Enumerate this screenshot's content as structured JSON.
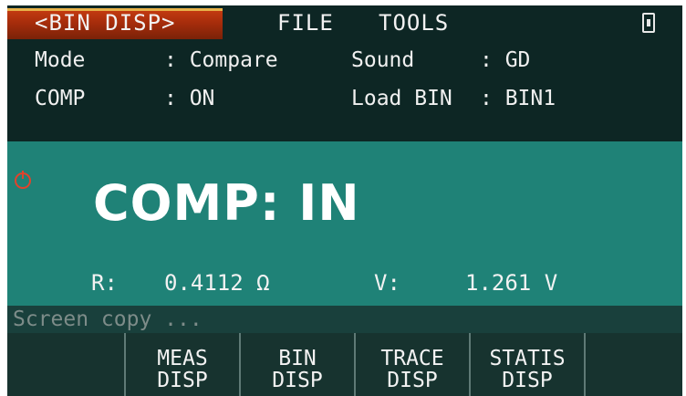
{
  "menu": {
    "active_tab": "<BIN DISP>",
    "file": "FILE",
    "tools": "TOOLS",
    "usb_icon": "usb-drive-icon"
  },
  "settings": {
    "mode_label": "Mode",
    "mode_value": ": Compare",
    "sound_label": "Sound",
    "sound_value": ": GD",
    "comp_label": "COMP",
    "comp_value": ": ON",
    "load_bin_label": "Load BIN",
    "load_bin_value": ": BIN1"
  },
  "display": {
    "power_icon": "power-icon",
    "result": "COMP: IN",
    "r_label": "R:",
    "r_value": "0.4112 Ω",
    "v_label": "V:",
    "v_value": "1.261 V"
  },
  "message": "Screen copy ...",
  "softkeys": [
    {
      "line1": "",
      "line2": ""
    },
    {
      "line1": "MEAS",
      "line2": "DISP"
    },
    {
      "line1": "BIN",
      "line2": "DISP"
    },
    {
      "line1": "TRACE",
      "line2": "DISP"
    },
    {
      "line1": "STATIS",
      "line2": "DISP"
    },
    {
      "line1": "",
      "line2": ""
    }
  ],
  "colors": {
    "active_tab": "#a42c0b",
    "background": "#0d2624",
    "display": "#1f8277",
    "alert": "#e0432c"
  }
}
